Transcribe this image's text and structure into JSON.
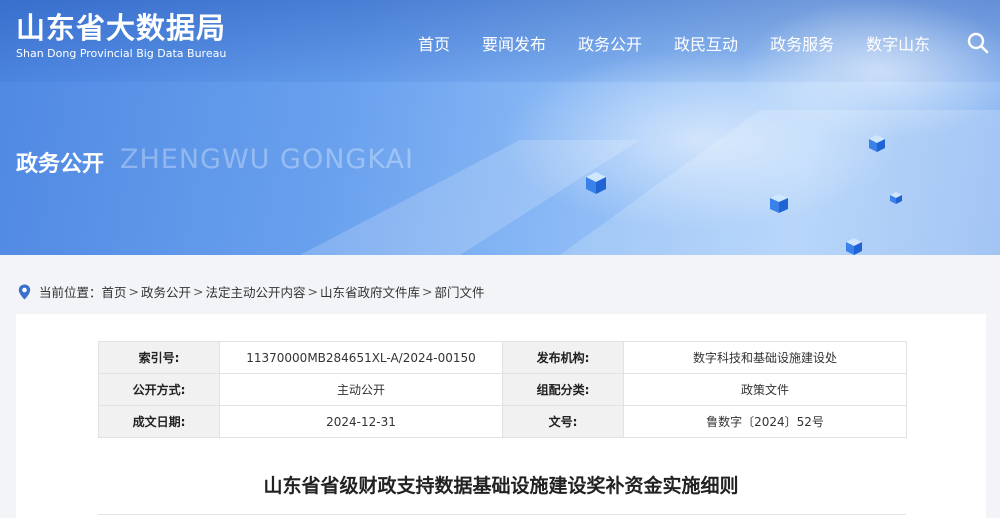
{
  "header": {
    "logo_cn": "山东省大数据局",
    "logo_en": "Shan Dong Provincial Big Data Bureau",
    "nav": [
      "首页",
      "要闻发布",
      "政务公开",
      "政民互动",
      "政务服务",
      "数字山东"
    ],
    "search_icon": "search-icon"
  },
  "banner": {
    "title_cn": "政务公开",
    "title_en": "ZHENGWU GONGKAI"
  },
  "breadcrumb": {
    "prefix": "当前位置：",
    "items": [
      "首页",
      "政务公开",
      "法定主动公开内容",
      "山东省政府文件库",
      "部门文件"
    ],
    "separator": ">"
  },
  "document": {
    "meta": {
      "index_no_label": "索引号:",
      "index_no": "11370000MB284651XL-A/2024-00150",
      "issuer_label": "发布机构:",
      "issuer": "数字科技和基础设施建设处",
      "open_mode_label": "公开方式:",
      "open_mode": "主动公开",
      "category_label": "组配分类:",
      "category": "政策文件",
      "date_label": "成文日期:",
      "date": "2024-12-31",
      "doc_no_label": "文号:",
      "doc_no": "鲁数字〔2024〕52号"
    },
    "title": "山东省省级财政支持数据基础设施建设奖补资金实施细则"
  },
  "colors": {
    "banner_blue": "#4f88e2",
    "label_bg": "#f1f1f1"
  }
}
